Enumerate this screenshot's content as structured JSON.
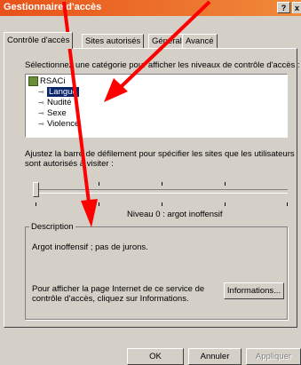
{
  "window": {
    "title": "Gestionnaire d'accès",
    "help": "?",
    "close_glyph": "x"
  },
  "tabs": [
    {
      "label": "Contrôle d'accès",
      "active": true
    },
    {
      "label": "Sites autorisés",
      "active": false
    },
    {
      "label": "Général",
      "active": false
    },
    {
      "label": "Avancé",
      "active": false
    }
  ],
  "category": {
    "instruction": "Sélectionnez une catégorie pour afficher les niveaux de contrôle d'accès :",
    "root": "RSACi",
    "items": [
      {
        "label": "Langue",
        "selected": true
      },
      {
        "label": "Nudité",
        "selected": false
      },
      {
        "label": "Sexe",
        "selected": false
      },
      {
        "label": "Violence",
        "selected": false
      }
    ]
  },
  "slider": {
    "instruction_line1": "Ajustez la barre de défilement pour spécifier les sites que les utilisateurs",
    "instruction_line2": "sont autorisés à visiter :",
    "level_label": "Niveau 0 : argot inoffensif",
    "value": 0,
    "max": 4
  },
  "description": {
    "legend": "Description",
    "text": "Argot inoffensif ; pas de jurons.",
    "info_line1": "Pour afficher la page Internet de ce service de",
    "info_line2": "contrôle d'accès, cliquez sur Informations.",
    "info_button": "Informations..."
  },
  "footer": {
    "ok": "OK",
    "cancel": "Annuler",
    "apply": "Appliquer"
  },
  "colors": {
    "annotation": "#ff0000",
    "titlebar": "#e8521a",
    "selection": "#0a246a"
  }
}
